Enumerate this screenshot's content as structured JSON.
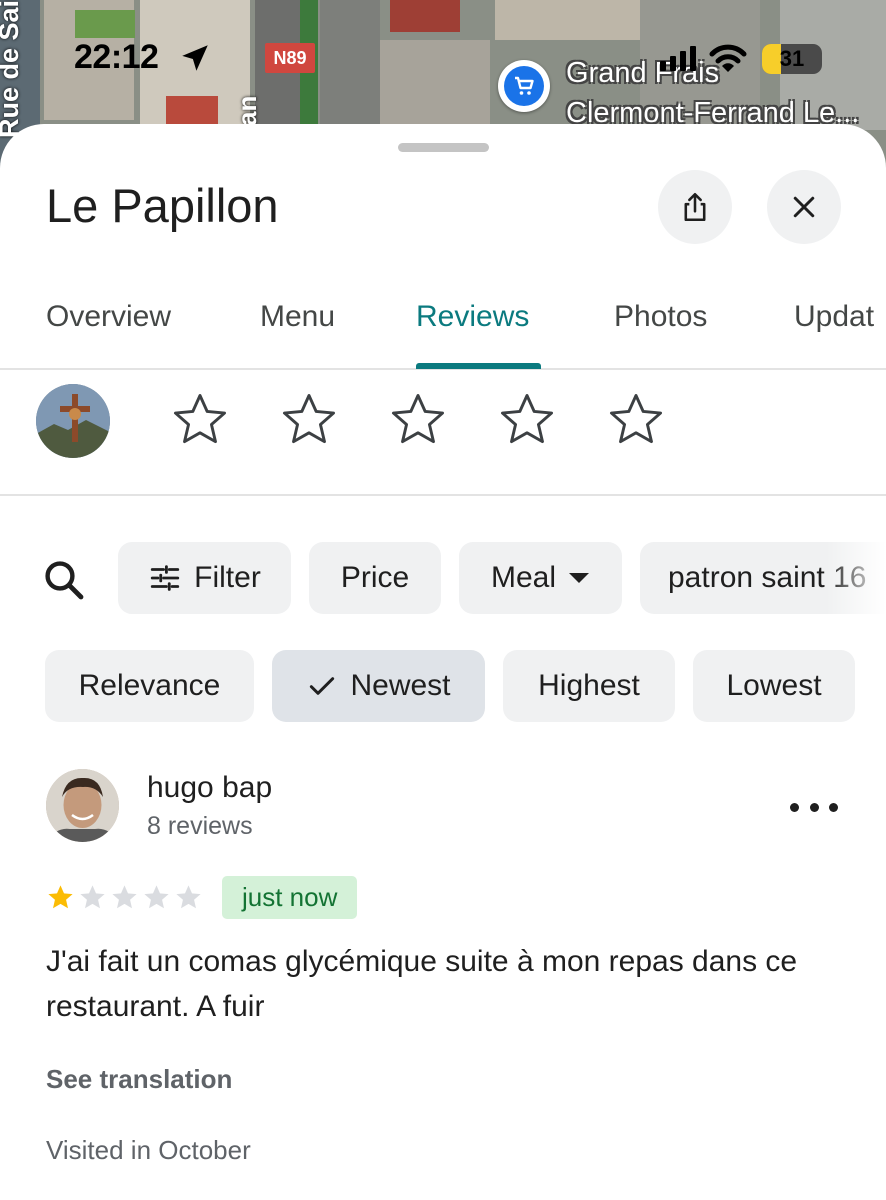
{
  "status_bar": {
    "time": "22:12",
    "battery": "31"
  },
  "map": {
    "street_label": "Rue de Sai",
    "road_fragment": "an",
    "road_badge": "N89",
    "poi_name_line1": "Grand Frais",
    "poi_name_line2": "Clermont-Ferrand Le..."
  },
  "place": {
    "title": "Le Papillon"
  },
  "tabs": [
    {
      "label": "Overview"
    },
    {
      "label": "Menu"
    },
    {
      "label": "Reviews",
      "active": true
    },
    {
      "label": "Photos"
    },
    {
      "label": "Updat"
    }
  ],
  "rating_prompt": {
    "stars": 5
  },
  "filters": {
    "filter_label": "Filter",
    "price_label": "Price",
    "meal_label": "Meal",
    "topic_label": "patron saint 16"
  },
  "sort": {
    "relevance": "Relevance",
    "newest": "Newest",
    "highest": "Highest",
    "lowest": "Lowest",
    "selected": "Newest"
  },
  "review": {
    "author": "hugo bap",
    "author_review_count": "8 reviews",
    "rating": 1,
    "max_rating": 5,
    "time_badge": "just now",
    "text": "J'ai fait un comas glycémique suite à mon repas dans ce restaurant. A fuir",
    "see_translation": "See translation",
    "visited": "Visited in October"
  },
  "colors": {
    "accent": "#0b7a7f",
    "star_filled": "#fbbc04",
    "star_empty": "#dadce0",
    "badge_bg": "#d4f1d8",
    "badge_text": "#137333",
    "chip_bg": "#f0f1f2"
  },
  "icons": [
    "share-icon",
    "close-icon",
    "search-icon",
    "filter-sliders-icon",
    "dropdown-arrow-icon",
    "check-icon",
    "more-vert-icon",
    "location-arrow-icon",
    "shopping-cart-icon"
  ]
}
